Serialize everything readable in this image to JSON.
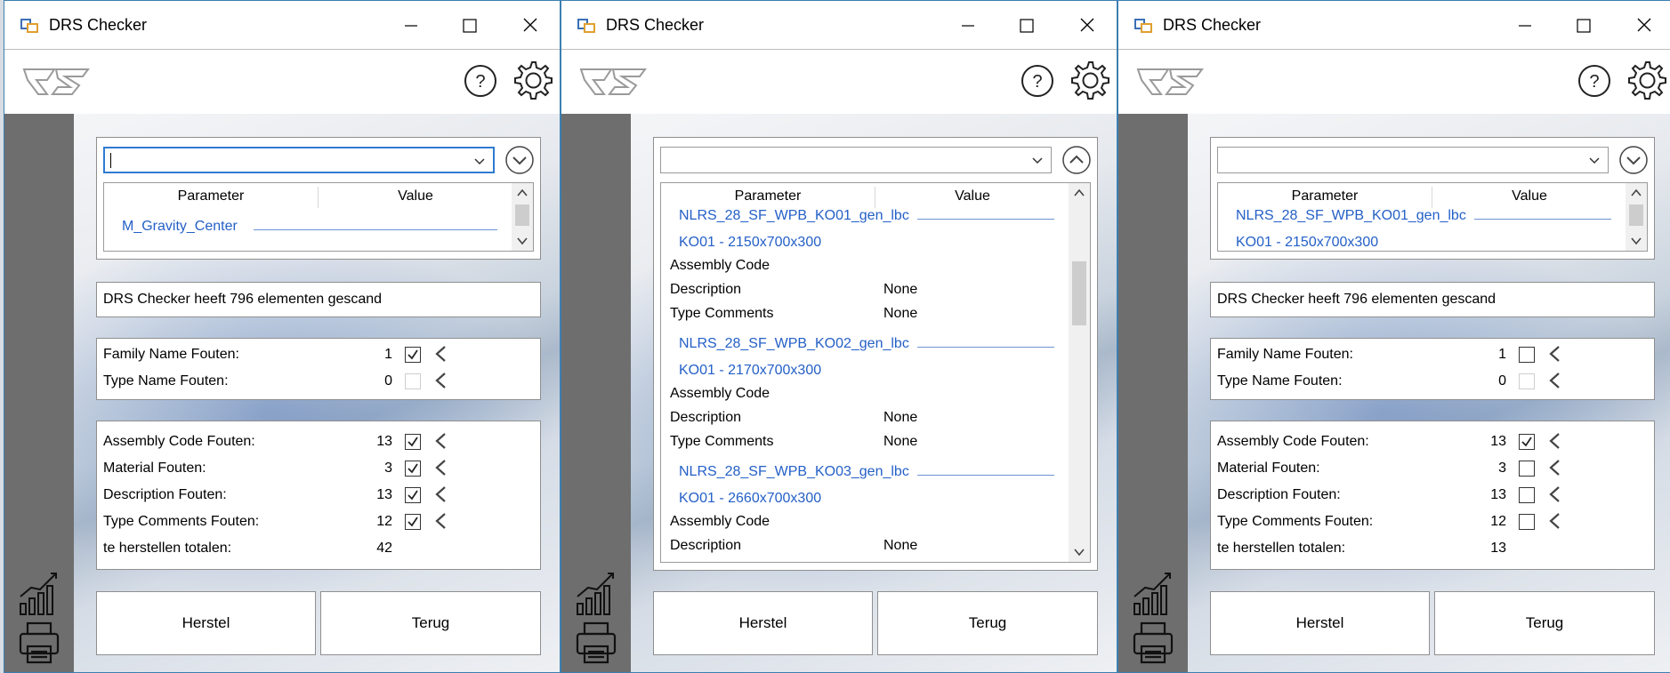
{
  "windows": [
    {
      "title": "DRS Checker",
      "dropdown_expanded": false,
      "grid": {
        "col_parameter": "Parameter",
        "col_value": "Value",
        "group": "M_Gravity_Center"
      },
      "status": "DRS Checker heeft 796 elementen gescand",
      "family_label": "Family Name Fouten:",
      "family_count": "1",
      "family_checked": true,
      "type_label": "Type Name Fouten:",
      "type_count": "0",
      "assembly_label": "Assembly Code Fouten:",
      "assembly_count": "13",
      "assembly_checked": true,
      "material_label": "Material Fouten:",
      "material_count": "3",
      "material_checked": true,
      "description_label": "Description Fouten:",
      "description_count": "13",
      "description_checked": true,
      "typecomments_label": "Type Comments Fouten:",
      "typecomments_count": "12",
      "typecomments_checked": true,
      "total_label": "te herstellen totalen:",
      "total_count": "42",
      "herstel_label": "Herstel",
      "terug_label": "Terug"
    },
    {
      "title": "DRS Checker",
      "dropdown_expanded": true,
      "grid": {
        "col_parameter": "Parameter",
        "col_value": "Value",
        "rows": [
          {
            "kind": "group",
            "text": "NLRS_28_SF_WPB_KO01_gen_lbc"
          },
          {
            "kind": "sub",
            "text": "KO01 - 2150x700x300"
          },
          {
            "kind": "item",
            "param": "Assembly Code",
            "value": ""
          },
          {
            "kind": "item",
            "param": "Description",
            "value": "None"
          },
          {
            "kind": "item",
            "param": "Type Comments",
            "value": "None"
          },
          {
            "kind": "group",
            "text": "NLRS_28_SF_WPB_KO02_gen_lbc"
          },
          {
            "kind": "sub",
            "text": "KO01 - 2170x700x300"
          },
          {
            "kind": "item",
            "param": "Assembly Code",
            "value": ""
          },
          {
            "kind": "item",
            "param": "Description",
            "value": "None"
          },
          {
            "kind": "item",
            "param": "Type Comments",
            "value": "None"
          },
          {
            "kind": "group",
            "text": "NLRS_28_SF_WPB_KO03_gen_lbc"
          },
          {
            "kind": "sub",
            "text": "KO01 - 2660x700x300"
          },
          {
            "kind": "item",
            "param": "Assembly Code",
            "value": ""
          },
          {
            "kind": "item",
            "param": "Description",
            "value": "None"
          }
        ]
      },
      "herstel_label": "Herstel",
      "terug_label": "Terug"
    },
    {
      "title": "DRS Checker",
      "dropdown_expanded": false,
      "grid": {
        "col_parameter": "Parameter",
        "col_value": "Value",
        "group": "NLRS_28_SF_WPB_KO01_gen_lbc",
        "sub": "KO01 - 2150x700x300"
      },
      "status": "DRS Checker heeft 796 elementen gescand",
      "family_label": "Family Name Fouten:",
      "family_count": "1",
      "family_checked": false,
      "type_label": "Type Name Fouten:",
      "type_count": "0",
      "assembly_label": "Assembly Code Fouten:",
      "assembly_count": "13",
      "assembly_checked": true,
      "material_label": "Material Fouten:",
      "material_count": "3",
      "material_checked": false,
      "description_label": "Description Fouten:",
      "description_count": "13",
      "description_checked": false,
      "typecomments_label": "Type Comments Fouten:",
      "typecomments_count": "12",
      "typecomments_checked": false,
      "total_label": "te herstellen totalen:",
      "total_count": "13",
      "herstel_label": "Herstel",
      "terug_label": "Terug"
    }
  ],
  "icons": {
    "app": "app-icon",
    "help": "help-icon",
    "settings": "gear-icon",
    "chart": "chart-icon",
    "print": "printer-icon"
  },
  "colors": {
    "accent": "#2f7bd1",
    "group_text": "#2460c7",
    "left_bar": "#6e6e6e"
  }
}
